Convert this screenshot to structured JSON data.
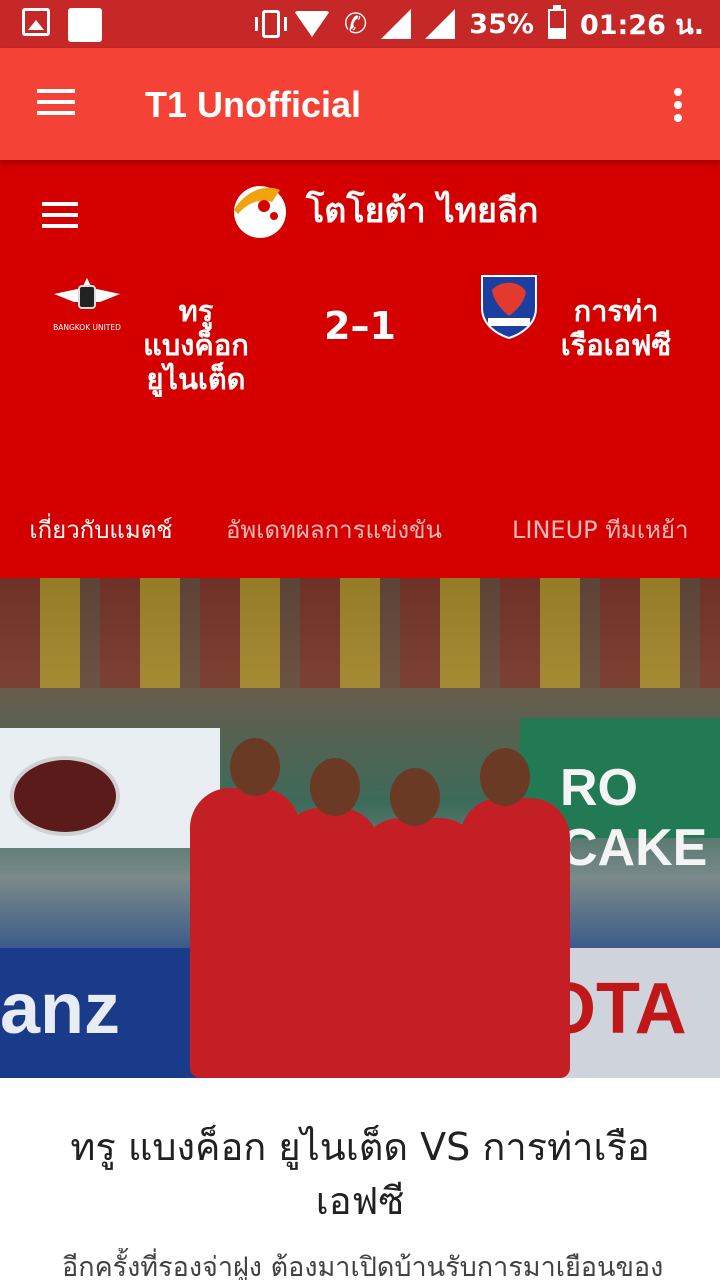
{
  "status_bar": {
    "battery": "35%",
    "time": "01:26 น.",
    "network": "LTE",
    "icons": [
      "image-icon",
      "notification-icon",
      "vibrate-icon",
      "wifi-icon",
      "call-lte-icon",
      "signal-x-icon",
      "signal-icon",
      "battery-icon"
    ]
  },
  "app_bar": {
    "title": "T1 Unofficial",
    "menu_icon": "hamburger-icon",
    "overflow_icon": "more-vert-icon"
  },
  "match": {
    "league_name": "โตโยต้า ไทยลีก",
    "home_team": "ทรู แบงค็อก ยูไนเต็ด",
    "home_logo_text": "BANGKOK UNITED",
    "away_team": "การท่าเรือเอฟซี",
    "score": "2–1"
  },
  "tabs": [
    {
      "label": "เกี่ยวกับแมตช์",
      "selected": true
    },
    {
      "label": "อัพเดทผลการแข่งขัน",
      "selected": false
    },
    {
      "label": "LINEUP ทีมเหย้า",
      "selected": false
    }
  ],
  "hero": {
    "board_right_text": "RO CAKE",
    "ad_text_left": "anz",
    "ad_text_right": "OTA"
  },
  "article": {
    "title": "ทรู แบงค็อก ยูไนเต็ด VS การท่าเรือเอฟซี",
    "body": "อีกครั้งที่รองจ่าฝูง ต้องมาเปิดบ้านรับการมาเยือนของ"
  },
  "colors": {
    "status_bar": "#c62828",
    "app_bar": "#f44336",
    "header": "#d40000"
  }
}
